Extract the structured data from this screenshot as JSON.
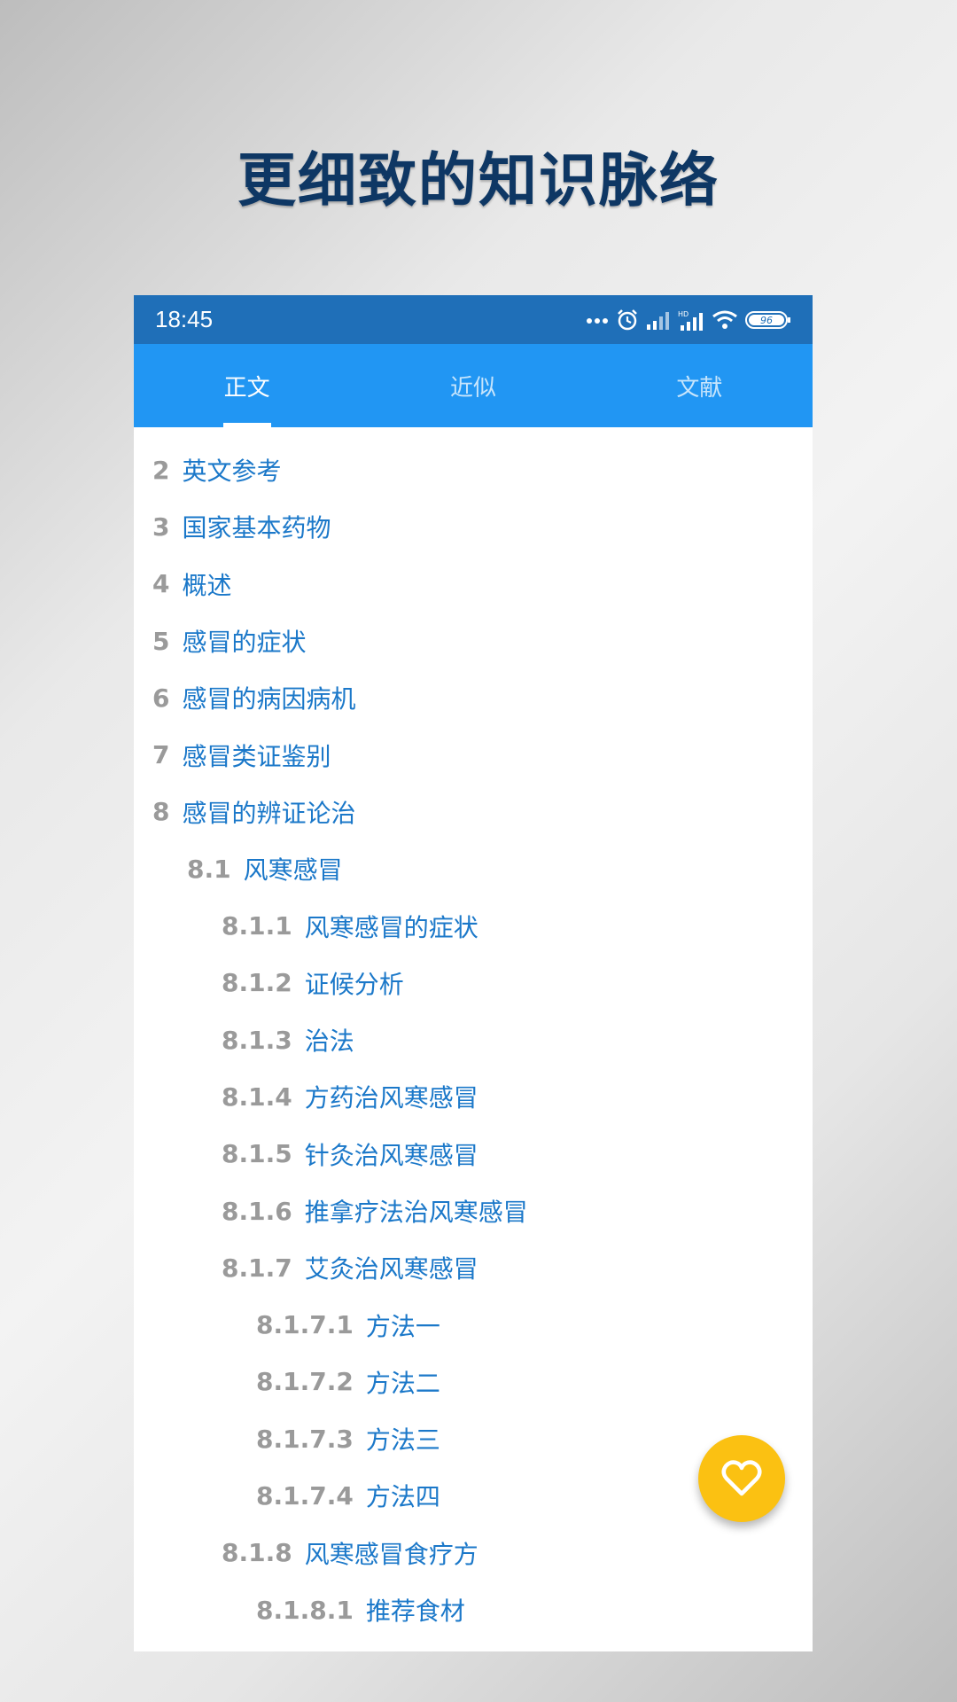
{
  "headline": "更细致的知识脉络",
  "status_bar": {
    "time": "18:45",
    "battery": "96"
  },
  "tabs": [
    {
      "label": "正文",
      "active": true
    },
    {
      "label": "近似",
      "active": false
    },
    {
      "label": "文献",
      "active": false
    }
  ],
  "toc": [
    {
      "num": "2",
      "label": "英文参考",
      "level": 1
    },
    {
      "num": "3",
      "label": "国家基本药物",
      "level": 1
    },
    {
      "num": "4",
      "label": "概述",
      "level": 1
    },
    {
      "num": "5",
      "label": "感冒的症状",
      "level": 1
    },
    {
      "num": "6",
      "label": "感冒的病因病机",
      "level": 1
    },
    {
      "num": "7",
      "label": "感冒类证鉴别",
      "level": 1
    },
    {
      "num": "8",
      "label": "感冒的辨证论治",
      "level": 1
    },
    {
      "num": "8.1",
      "label": "风寒感冒",
      "level": 2
    },
    {
      "num": "8.1.1",
      "label": "风寒感冒的症状",
      "level": 3
    },
    {
      "num": "8.1.2",
      "label": "证候分析",
      "level": 3
    },
    {
      "num": "8.1.3",
      "label": "治法",
      "level": 3
    },
    {
      "num": "8.1.4",
      "label": "方药治风寒感冒",
      "level": 3
    },
    {
      "num": "8.1.5",
      "label": "针灸治风寒感冒",
      "level": 3
    },
    {
      "num": "8.1.6",
      "label": "推拿疗法治风寒感冒",
      "level": 3
    },
    {
      "num": "8.1.7",
      "label": "艾灸治风寒感冒",
      "level": 3
    },
    {
      "num": "8.1.7.1",
      "label": "方法一",
      "level": 4
    },
    {
      "num": "8.1.7.2",
      "label": "方法二",
      "level": 4
    },
    {
      "num": "8.1.7.3",
      "label": "方法三",
      "level": 4
    },
    {
      "num": "8.1.7.4",
      "label": "方法四",
      "level": 4
    },
    {
      "num": "8.1.8",
      "label": "风寒感冒食疗方",
      "level": 3
    },
    {
      "num": "8.1.8.1",
      "label": "推荐食材",
      "level": 4
    }
  ],
  "colors": {
    "status_bar": "#1f6fb8",
    "tab_bar": "#2196f3",
    "toc_label": "#1b78c9",
    "toc_number": "#9a9a9a",
    "fab": "#fbc112"
  },
  "fab_icon": "heart-icon"
}
